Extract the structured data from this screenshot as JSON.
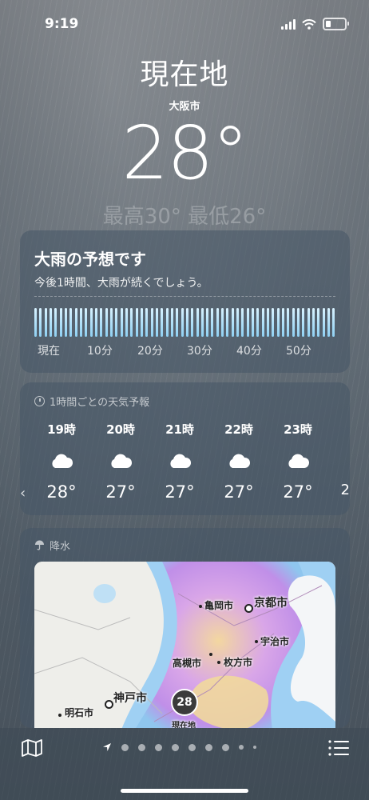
{
  "status": {
    "time": "9:19"
  },
  "location": {
    "title": "現在地",
    "city": "大阪市"
  },
  "current": {
    "temp": "28°",
    "hi_lo": "最高30° 最低26°"
  },
  "precip_card": {
    "title": "大雨の予想です",
    "description": "今後1時間、大雨が続くでしょう。",
    "ticks": [
      "現在",
      "10分",
      "20分",
      "30分",
      "40分",
      "50分"
    ]
  },
  "hourly": {
    "header": "1時間ごとの天気予報",
    "icon": "clock-icon",
    "items": [
      {
        "time": "19時",
        "icon": "cloud-icon",
        "temp": "28°"
      },
      {
        "time": "20時",
        "icon": "cloud-icon",
        "temp": "27°"
      },
      {
        "time": "21時",
        "icon": "cloud-icon",
        "temp": "27°"
      },
      {
        "time": "22時",
        "icon": "cloud-icon",
        "temp": "27°"
      },
      {
        "time": "23時",
        "icon": "cloud-icon",
        "temp": "27°"
      }
    ],
    "next_partial": "2"
  },
  "precip_map": {
    "header": "降水",
    "icon": "umbrella-icon",
    "labels": {
      "kameoka": "亀岡市",
      "kyoto": "京都市",
      "uji": "宇治市",
      "takatsuki": "高槻市",
      "hirakata": "枚方市",
      "kobe": "神戸市",
      "akashi": "明石市",
      "current": "現在地"
    },
    "badge": "28"
  },
  "colors": {
    "bar": "#a9dcf6",
    "precip_purple": "#c98be6",
    "precip_yellow": "#f5e3a0"
  }
}
